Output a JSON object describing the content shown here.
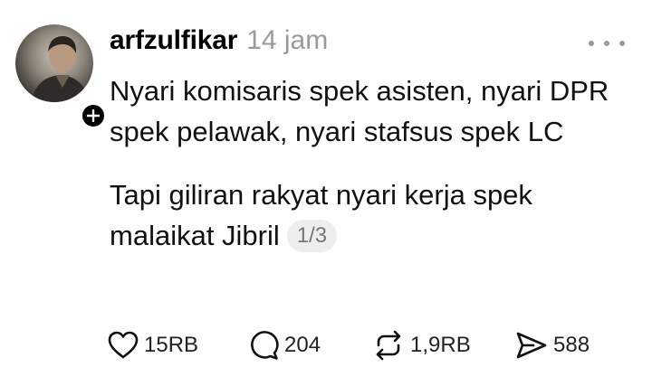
{
  "post": {
    "username": "arfzulfikar",
    "timestamp": "14 jam",
    "paragraph_1": "Nyari komisaris spek asisten, nyari DPR spek pelawak, nyari stafsus spek LC",
    "paragraph_2": "Tapi giliran rakyat nyari kerja spek malaikat Jibril",
    "page_indicator": "1/3"
  },
  "actions": {
    "likes": "15RB",
    "replies": "204",
    "reposts": "1,9RB",
    "shares": "588"
  },
  "icons": {
    "follow": "plus-icon",
    "more": "more-dots-icon",
    "like": "heart-icon",
    "reply": "comment-icon",
    "repost": "repost-icon",
    "share": "send-icon"
  },
  "colors": {
    "text": "#000000",
    "muted": "#9a9a9a",
    "pill_bg": "#eeeeee"
  }
}
